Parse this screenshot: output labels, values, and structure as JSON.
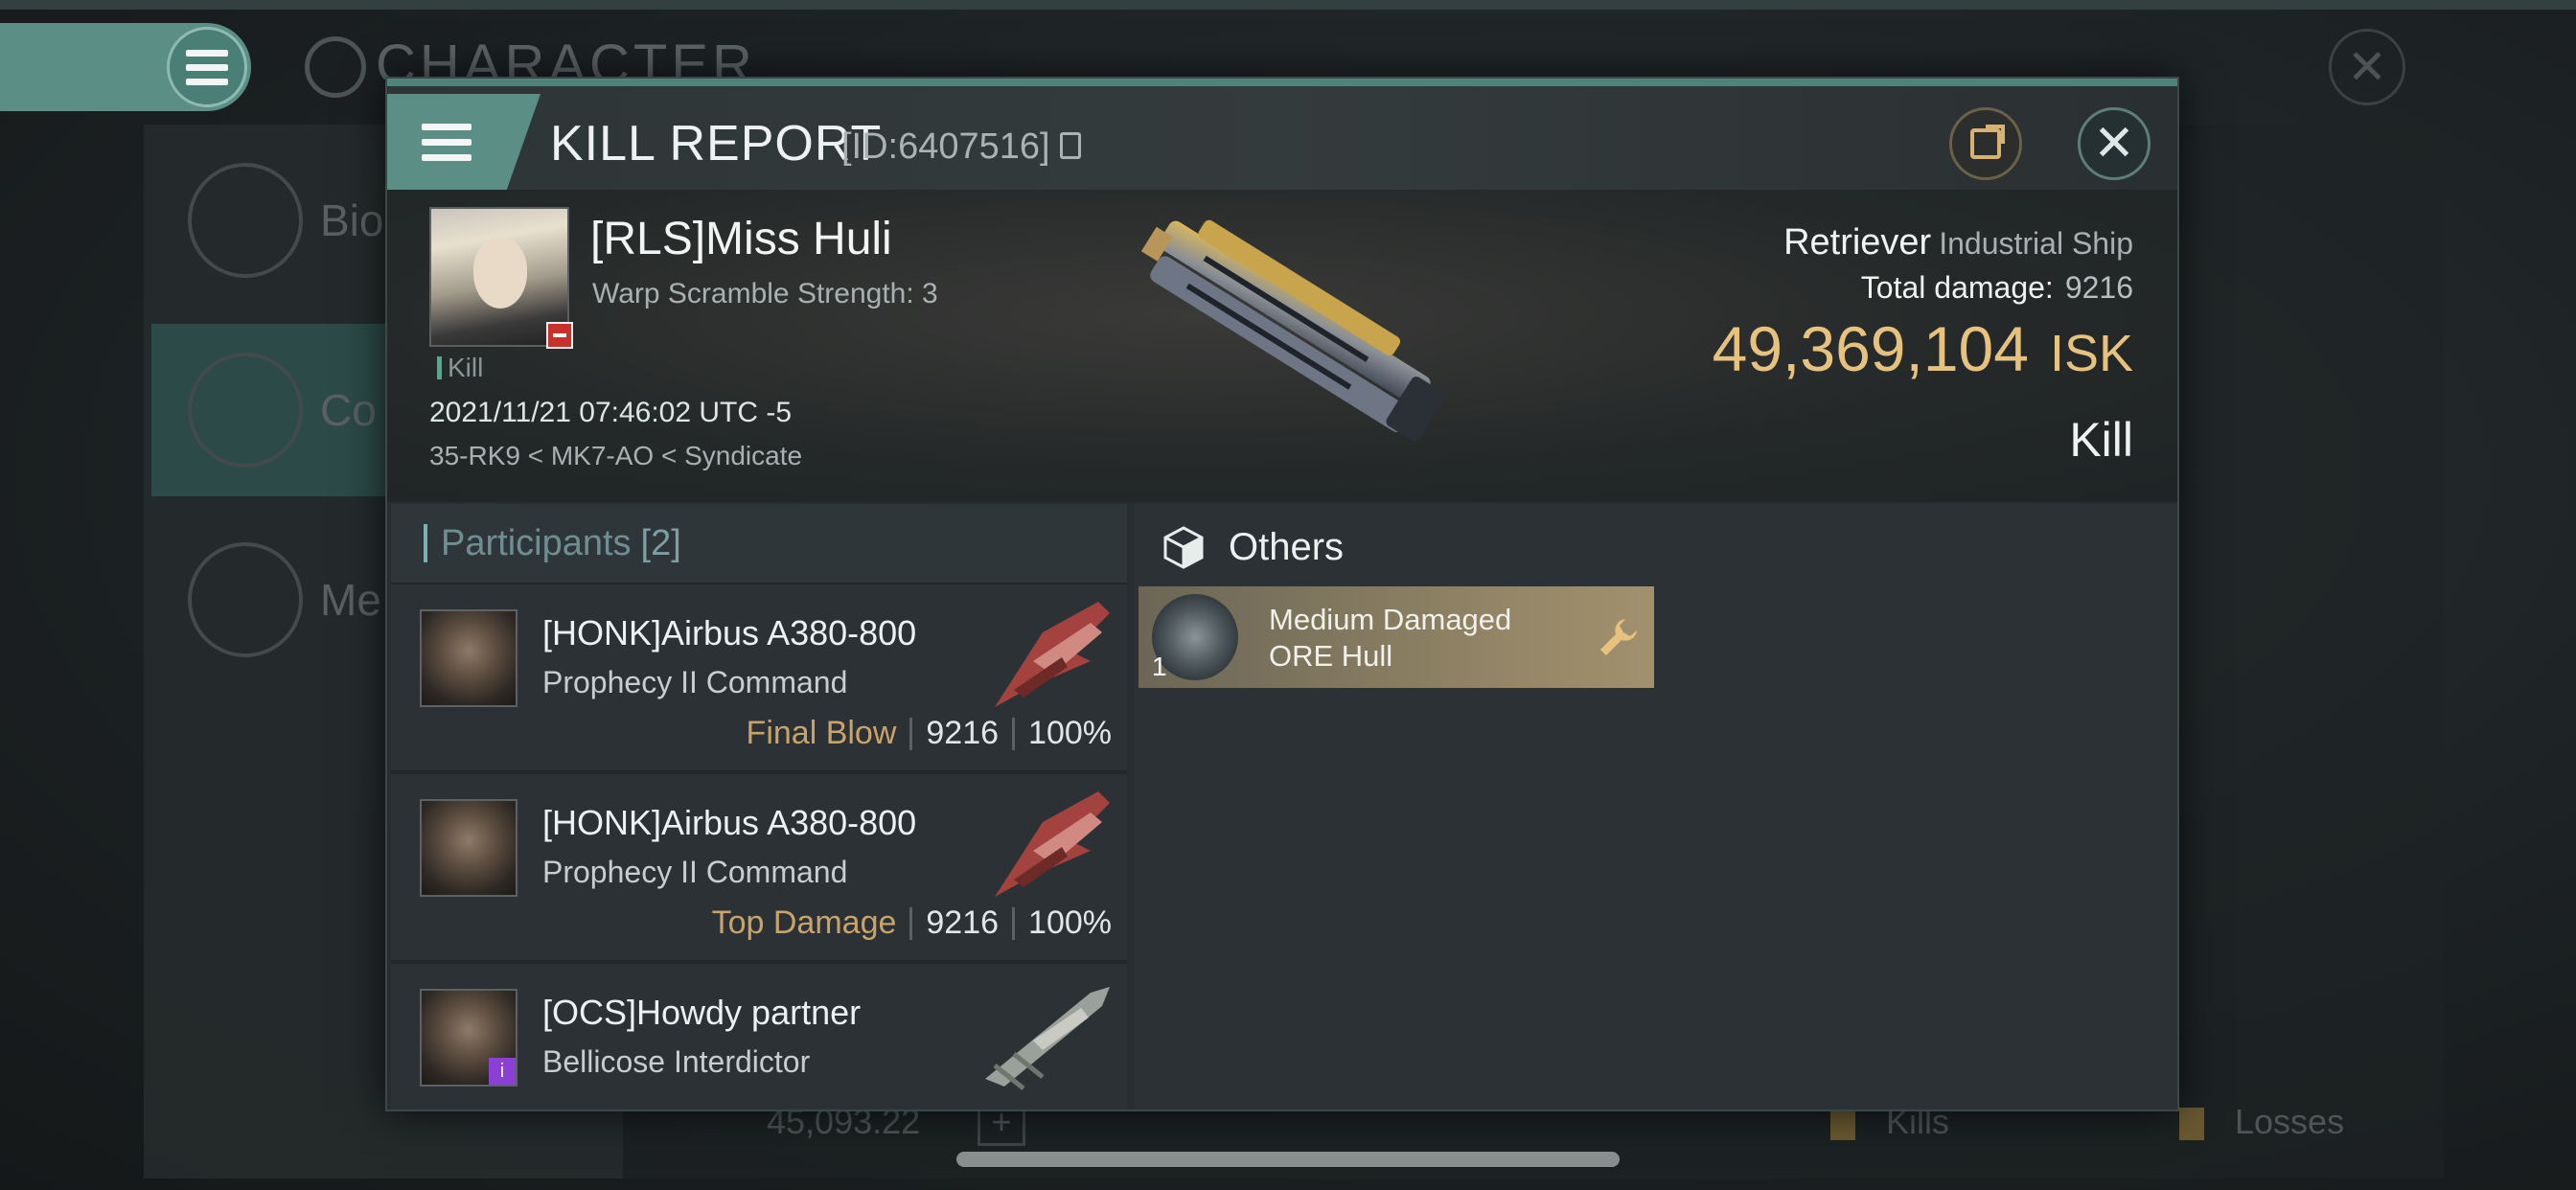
{
  "background": {
    "title": "CHARACTER",
    "sidebar": [
      {
        "label": "Bio",
        "active": false
      },
      {
        "label": "Co",
        "active": true
      },
      {
        "label": "Me",
        "active": false
      }
    ],
    "footer": {
      "balance": "45,093.22",
      "kills_label": "Kills",
      "losses_label": "Losses"
    }
  },
  "header": {
    "title": "KILL REPORT",
    "id_label": "[ID:6407516]"
  },
  "victim": {
    "name": "[RLS]Miss Huli",
    "subtitle": "Warp Scramble Strength: 3",
    "tag": "Kill",
    "datetime": "2021/11/21 07:46:02 UTC -5",
    "location": "35-RK9 < MK7-AO < Syndicate",
    "ship_name": "Retriever",
    "ship_class": "Industrial Ship",
    "total_damage_label": "Total damage:",
    "total_damage": "9216",
    "isk_value": "49,369,104",
    "isk_currency": "ISK",
    "result": "Kill"
  },
  "participants": {
    "label": "Participants",
    "count": "[2]",
    "rows": [
      {
        "name": "[HONK]Airbus A380-800",
        "ship": "Prophecy II Command",
        "role": "Final Blow",
        "damage": "9216",
        "percent": "100%"
      },
      {
        "name": "[HONK]Airbus A380-800",
        "ship": "Prophecy II Command",
        "role": "Top Damage",
        "damage": "9216",
        "percent": "100%"
      },
      {
        "name": "[OCS]Howdy partner",
        "ship": "Bellicose Interdictor",
        "role": "",
        "damage": "",
        "percent": ""
      }
    ]
  },
  "others": {
    "label": "Others",
    "items": [
      {
        "quantity": "1",
        "name_line1": "Medium Damaged",
        "name_line2": "ORE Hull"
      }
    ]
  },
  "colors": {
    "accent": "#5b8f86",
    "isk_gold": "#e7c17e",
    "role_gold": "#c9a46a",
    "item_bg": "#938566"
  }
}
